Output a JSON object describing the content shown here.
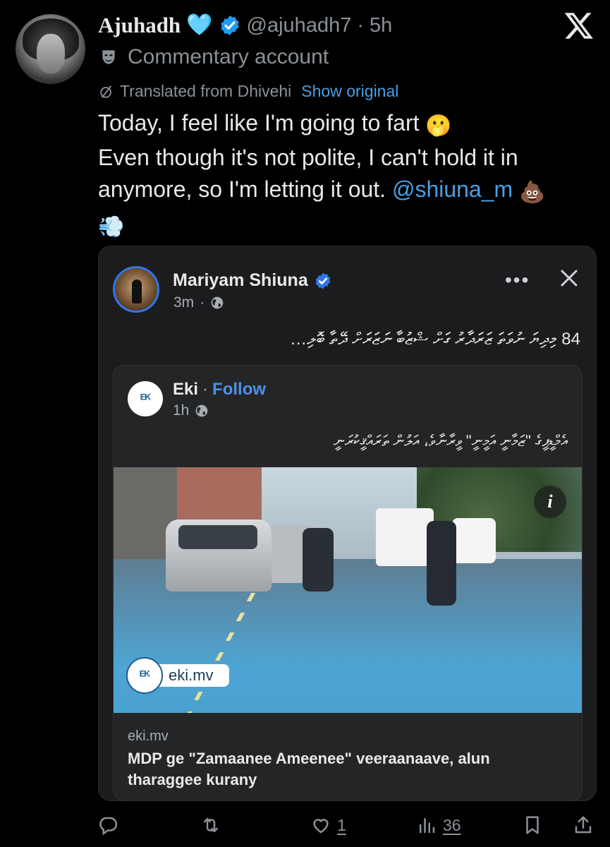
{
  "author": {
    "name": "Ajuhadh",
    "handle": "@ajuhadh7",
    "separator": "·",
    "time": "5h",
    "label": "Commentary account",
    "heart_emoji": "🩵"
  },
  "translation": {
    "note": "Translated from Dhivehi",
    "show_original": "Show original"
  },
  "tweet": {
    "line1": "Today, I feel like I'm going to fart",
    "line1_emoji": "🫢",
    "line2": "Even though it's not polite, I can't hold it in anymore, so I'm letting it out.",
    "mention": "@shiuna_m",
    "poop_emoji": "💩",
    "dash_emoji": "💨"
  },
  "quote": {
    "name": "Mariyam Shiuna",
    "time": "3m",
    "meta_dot": "·",
    "more": "•••",
    "text": "84 މިދިޔަ ނުވަތަ ޒަރަދާރު ގަށް ޝްޒުބާ ނަޒަރަށް ދޭތާ ބޮލި…",
    "inner": {
      "name": "Eki",
      "dot": "·",
      "follow": "Follow",
      "time": "1h",
      "text": "އެމްޑީޕީގެ \"ޒަމާނީ އަމީނީ\" ވީރާނާވެ، އަލުން ތަރައްޤީކުރަނީ",
      "logo_text": "ᴱᴷ",
      "badge_text": "eki.mv",
      "link_domain": "eki.mv",
      "link_title": "MDP ge \"Zamaanee Ameenee\" veeraanaave, alun tharaggee kurany"
    }
  },
  "actions": {
    "likes": "1",
    "views": "36"
  },
  "colors": {
    "background": "#000000",
    "link_blue": "#4a9fe5",
    "muted": "#8b9197",
    "card": "#1c1c1e",
    "fb_blue": "#2d78e6"
  },
  "icons": [
    "x-logo-icon",
    "verified-icon",
    "mask-icon",
    "translate-icon",
    "globe-icon",
    "more-icon",
    "close-icon",
    "info-icon",
    "reply-icon",
    "repost-icon",
    "like-icon",
    "views-icon",
    "bookmark-icon",
    "share-icon"
  ]
}
